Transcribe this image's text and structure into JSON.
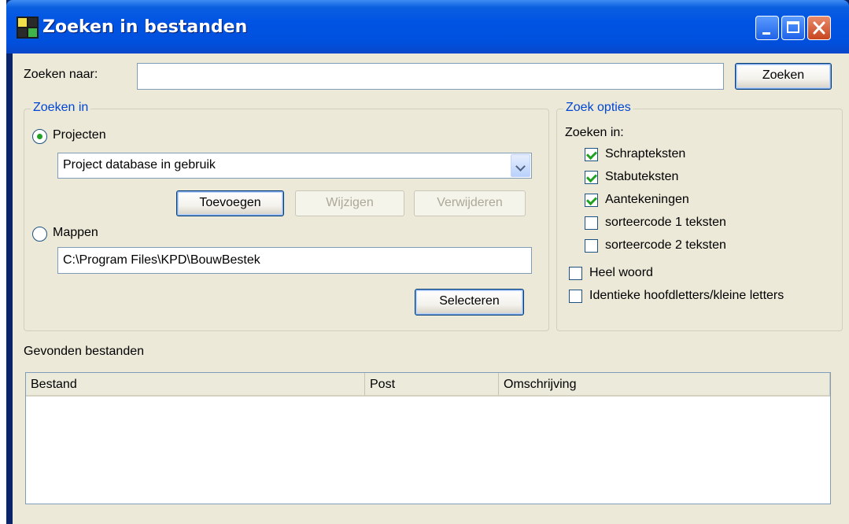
{
  "window": {
    "title": "Zoeken in bestanden",
    "buttons": {
      "minimize": "minimize",
      "maximize": "maximize",
      "close": "close"
    }
  },
  "search": {
    "label": "Zoeken naar:",
    "value": "",
    "button": "Zoeken"
  },
  "search_in": {
    "legend": "Zoeken in",
    "projects_label": "Projecten",
    "projects_selected": true,
    "project_value": "Project database in gebruik",
    "add_button": "Toevoegen",
    "edit_button": "Wijzigen",
    "delete_button": "Verwijderen",
    "folders_label": "Mappen",
    "folders_selected": false,
    "folder_value": "C:\\Program Files\\KPD\\BouwBestek",
    "select_button": "Selecteren"
  },
  "options": {
    "legend": "Zoek opties",
    "search_in_label": "Zoeken in:",
    "items": [
      {
        "label": "Schrapteksten",
        "checked": true
      },
      {
        "label": "Stabuteksten",
        "checked": true
      },
      {
        "label": "Aantekeningen",
        "checked": true
      },
      {
        "label": "sorteercode 1 teksten",
        "checked": false
      },
      {
        "label": "sorteercode 2 teksten",
        "checked": false
      }
    ],
    "whole_word": {
      "label": "Heel woord",
      "checked": false
    },
    "match_case": {
      "label": "Identieke hoofdletters/kleine letters",
      "checked": false
    }
  },
  "results": {
    "label": "Gevonden bestanden",
    "columns": [
      "Bestand",
      "Post",
      "Omschrijving"
    ],
    "rows": []
  },
  "colors": {
    "titlebar": "#0054e3",
    "dialog_bg": "#ece9d8",
    "group_legend": "#0046d5",
    "check_mark": "#21a121"
  }
}
